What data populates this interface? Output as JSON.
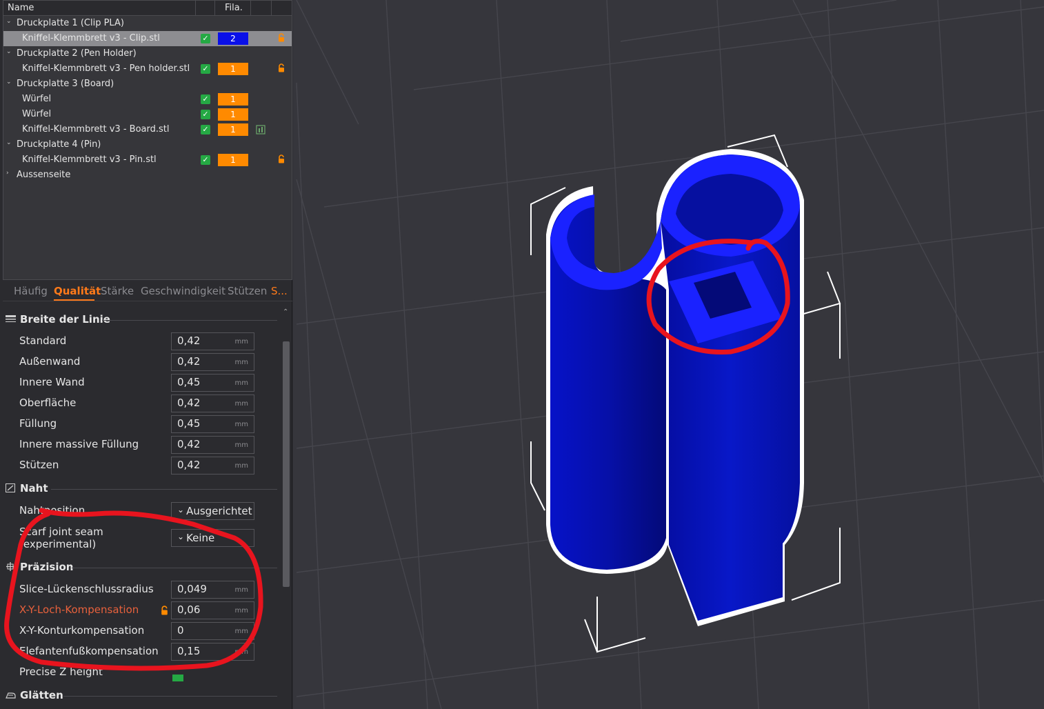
{
  "object_list": {
    "header": {
      "name": "Name",
      "filament": "Fila."
    },
    "rows": [
      {
        "type": "plate",
        "label": "Druckplatte 1 (Clip PLA)"
      },
      {
        "type": "object",
        "label": "Kniffel-Klemmbrett v3 - Clip.stl",
        "filament": "2",
        "filament_color": "#0a10e8",
        "selected": true,
        "badge": "lock"
      },
      {
        "type": "plate",
        "label": "Druckplatte 2 (Pen Holder)"
      },
      {
        "type": "object",
        "label": "Kniffel-Klemmbrett v3 - Pen holder.stl",
        "filament": "1",
        "filament_color": "#ff8a00",
        "badge": "lock"
      },
      {
        "type": "plate",
        "label": "Druckplatte 3 (Board)"
      },
      {
        "type": "object",
        "label": "Würfel",
        "filament": "1",
        "filament_color": "#ff8a00"
      },
      {
        "type": "object",
        "label": "Würfel",
        "filament": "1",
        "filament_color": "#ff8a00"
      },
      {
        "type": "object",
        "label": "Kniffel-Klemmbrett v3 - Board.stl",
        "filament": "1",
        "filament_color": "#ff8a00",
        "badge": "modifier"
      },
      {
        "type": "plate",
        "label": "Druckplatte 4 (Pin)"
      },
      {
        "type": "object",
        "label": "Kniffel-Klemmbrett v3 - Pin.stl",
        "filament": "1",
        "filament_color": "#ff8a00",
        "badge": "lock"
      },
      {
        "type": "plate-collapsed",
        "label": "Aussenseite"
      }
    ]
  },
  "tabs": [
    {
      "label": "Häufig",
      "active": false
    },
    {
      "label": "Qualität",
      "active": true
    },
    {
      "label": "Stärke",
      "active": false
    },
    {
      "label": "Geschwindigkeit",
      "active": false
    },
    {
      "label": "Stützen",
      "active": false
    },
    {
      "label": "S...",
      "active": false,
      "accent": true
    }
  ],
  "sections": {
    "line_width": {
      "title": "Breite der Linie",
      "rows": [
        {
          "label": "Standard",
          "value": "0,42",
          "unit": "mm"
        },
        {
          "label": "Außenwand",
          "value": "0,42",
          "unit": "mm"
        },
        {
          "label": "Innere Wand",
          "value": "0,45",
          "unit": "mm"
        },
        {
          "label": "Oberfläche",
          "value": "0,42",
          "unit": "mm"
        },
        {
          "label": "Füllung",
          "value": "0,45",
          "unit": "mm"
        },
        {
          "label": "Innere massive Füllung",
          "value": "0,42",
          "unit": "mm"
        },
        {
          "label": "Stützen",
          "value": "0,42",
          "unit": "mm"
        }
      ]
    },
    "seam": {
      "title": "Naht",
      "rows": [
        {
          "label": "Nahtposition",
          "value": "Ausgerichtet"
        },
        {
          "label_line1": "Scarf joint seam",
          "label_line2": "(experimental)",
          "value": "Keine"
        }
      ]
    },
    "precision": {
      "title": "Präzision",
      "rows": [
        {
          "label": "Slice-Lückenschlussradius",
          "value": "0,049",
          "unit": "mm"
        },
        {
          "label": "X-Y-Loch-Kompensation",
          "value": "0,06",
          "unit": "mm",
          "modified": true
        },
        {
          "label": "X-Y-Konturkompensation",
          "value": "0",
          "unit": "mm"
        },
        {
          "label": "Elefantenfußkompensation",
          "value": "0,15",
          "unit": "mm"
        },
        {
          "label": "Precise Z height",
          "checked": true
        }
      ]
    },
    "ironing": {
      "title": "Glätten"
    }
  },
  "colors": {
    "accent": "#ff7a1a",
    "model_blue": "#0a10e8",
    "annotation_red": "#e8141e",
    "checkbox_green": "#25a944"
  }
}
